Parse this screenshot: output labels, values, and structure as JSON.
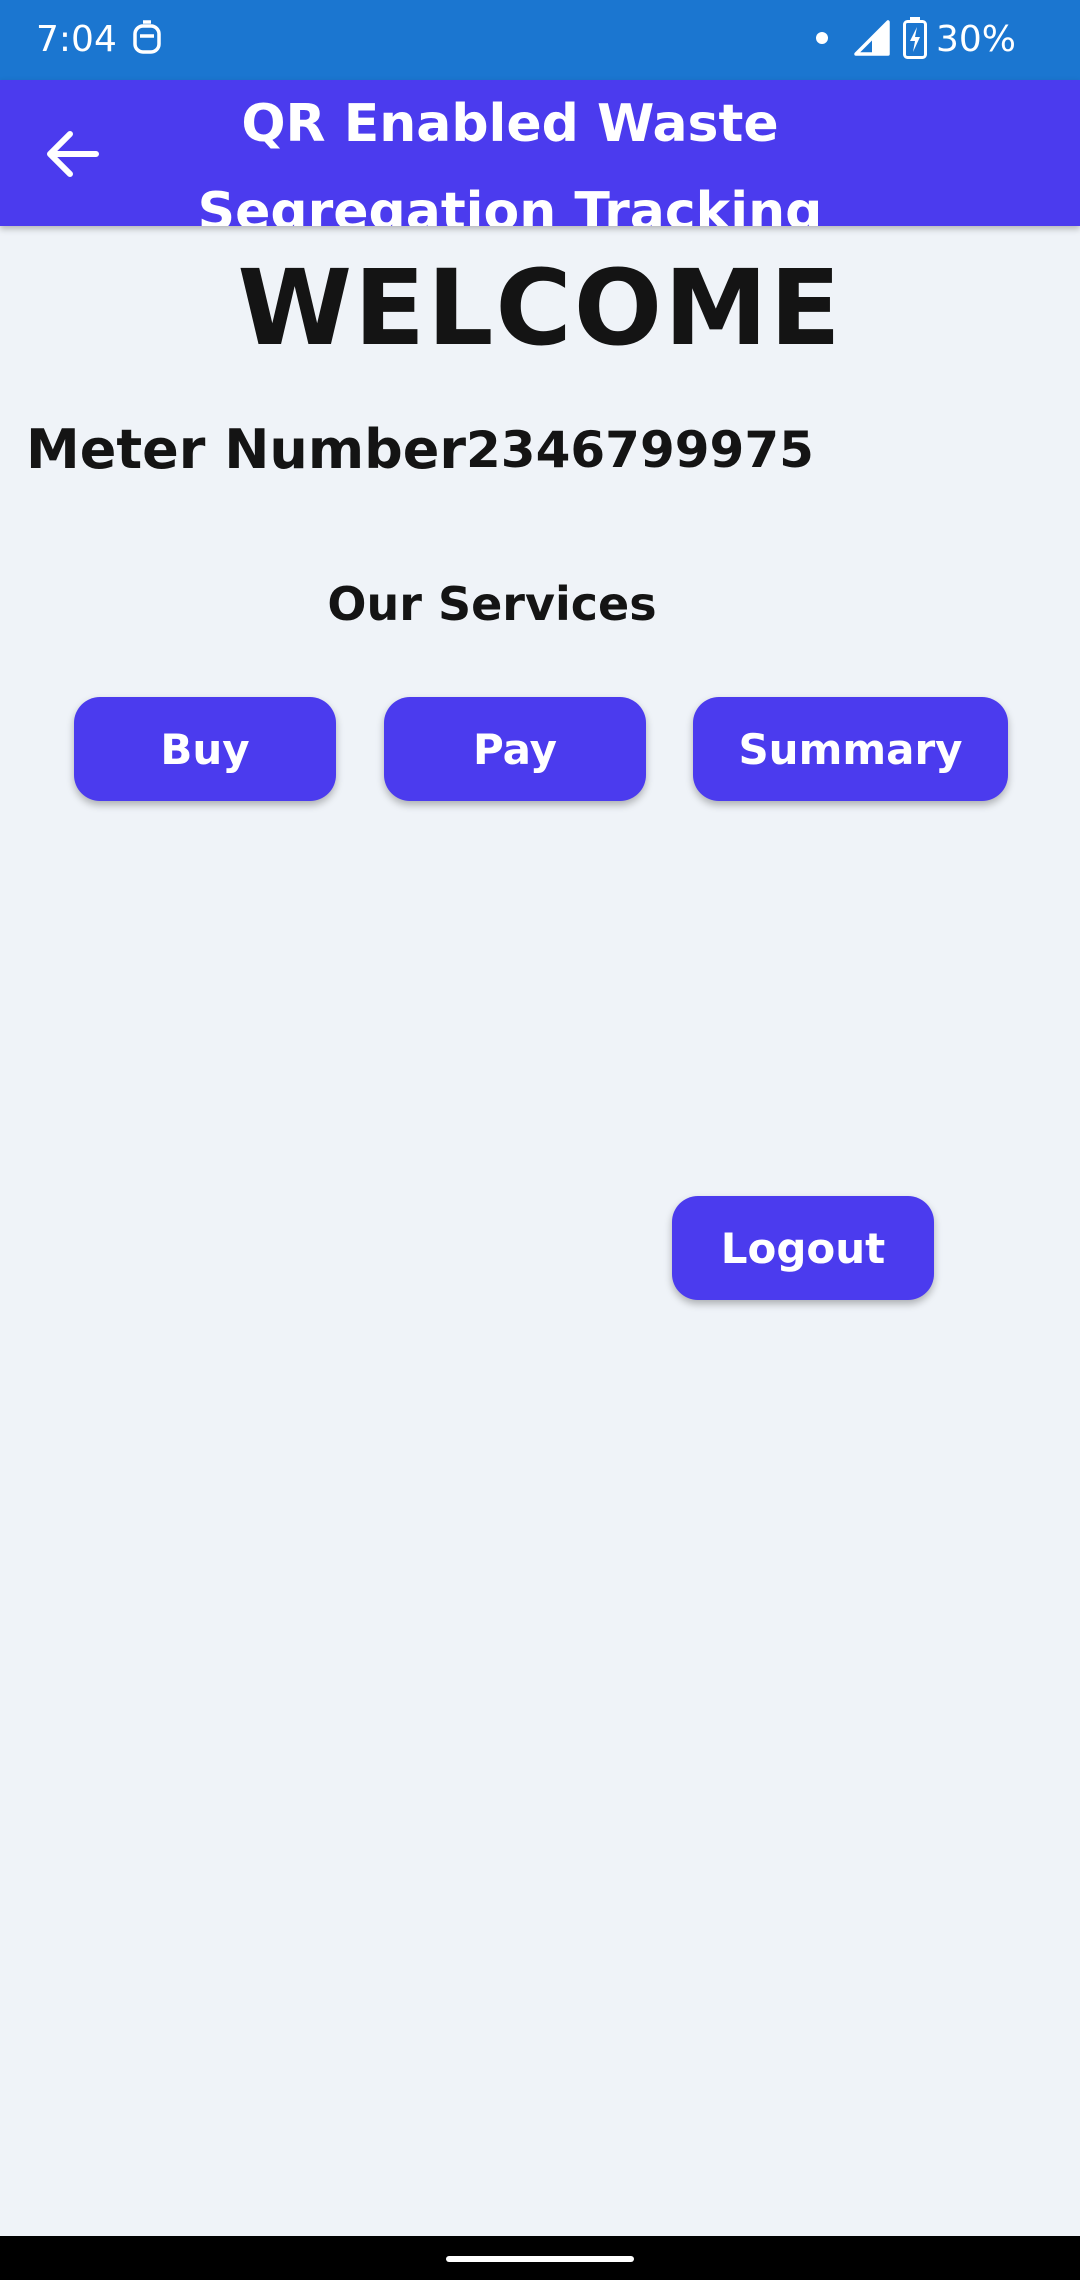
{
  "status_bar": {
    "time": "7:04",
    "battery_percent": "30%",
    "icons": [
      "notification-app-icon",
      "dot-icon",
      "cell-signal-icon",
      "battery-charging-icon"
    ],
    "background_color": "#1b76d0"
  },
  "app_bar": {
    "title": "QR Enabled Waste Segregation Tracking",
    "back_icon": "arrow-back-icon",
    "background_color": "#4b3bee"
  },
  "main": {
    "welcome": "WELCOME",
    "meter_label": "Meter Number",
    "meter_value": "2346799975",
    "services_title": "Our Services",
    "buttons": {
      "buy": "Buy",
      "pay": "Pay",
      "summary": "Summary",
      "logout": "Logout"
    },
    "button_color": "#4b3bee",
    "background_color": "#eff3f8"
  }
}
